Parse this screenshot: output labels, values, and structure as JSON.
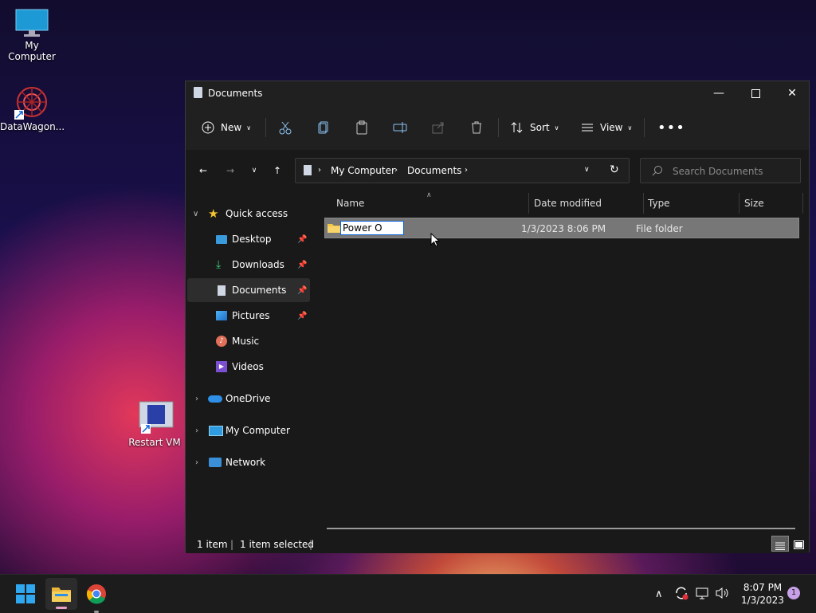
{
  "desktop": {
    "icons": [
      {
        "label": "My Computer"
      },
      {
        "label": "DataWagon..."
      },
      {
        "label": "Restart VM"
      }
    ]
  },
  "window": {
    "title": "Documents",
    "toolbar": {
      "new_label": "New",
      "sort_label": "Sort",
      "view_label": "View"
    },
    "breadcrumb": [
      "My Computer",
      "Documents"
    ],
    "search_placeholder": "Search Documents",
    "sidebar": {
      "quick_access": "Quick access",
      "pinned": [
        {
          "label": "Desktop",
          "icon": "desktop-icon",
          "pinned": true
        },
        {
          "label": "Downloads",
          "icon": "download-icon",
          "pinned": true
        },
        {
          "label": "Documents",
          "icon": "document-icon",
          "pinned": true,
          "selected": true
        },
        {
          "label": "Pictures",
          "icon": "pictures-icon",
          "pinned": true
        },
        {
          "label": "Music",
          "icon": "music-icon",
          "pinned": false
        },
        {
          "label": "Videos",
          "icon": "videos-icon",
          "pinned": false
        }
      ],
      "roots": [
        {
          "label": "OneDrive",
          "icon": "onedrive-icon"
        },
        {
          "label": "My Computer",
          "icon": "computer-icon"
        },
        {
          "label": "Network",
          "icon": "network-icon"
        }
      ]
    },
    "columns": [
      "Name",
      "Date modified",
      "Type",
      "Size"
    ],
    "files": [
      {
        "name_editing": "Power O",
        "date_modified": "1/3/2023 8:06 PM",
        "type": "File folder",
        "size": ""
      }
    ],
    "status": {
      "count": "1 item",
      "selected": "1 item selected"
    }
  },
  "taskbar": {
    "clock_time": "8:07 PM",
    "clock_date": "1/3/2023",
    "notification_count": "1"
  },
  "colors": {
    "accent": "#0a64d6",
    "folder": "#f2c744",
    "selection": "#777777"
  }
}
